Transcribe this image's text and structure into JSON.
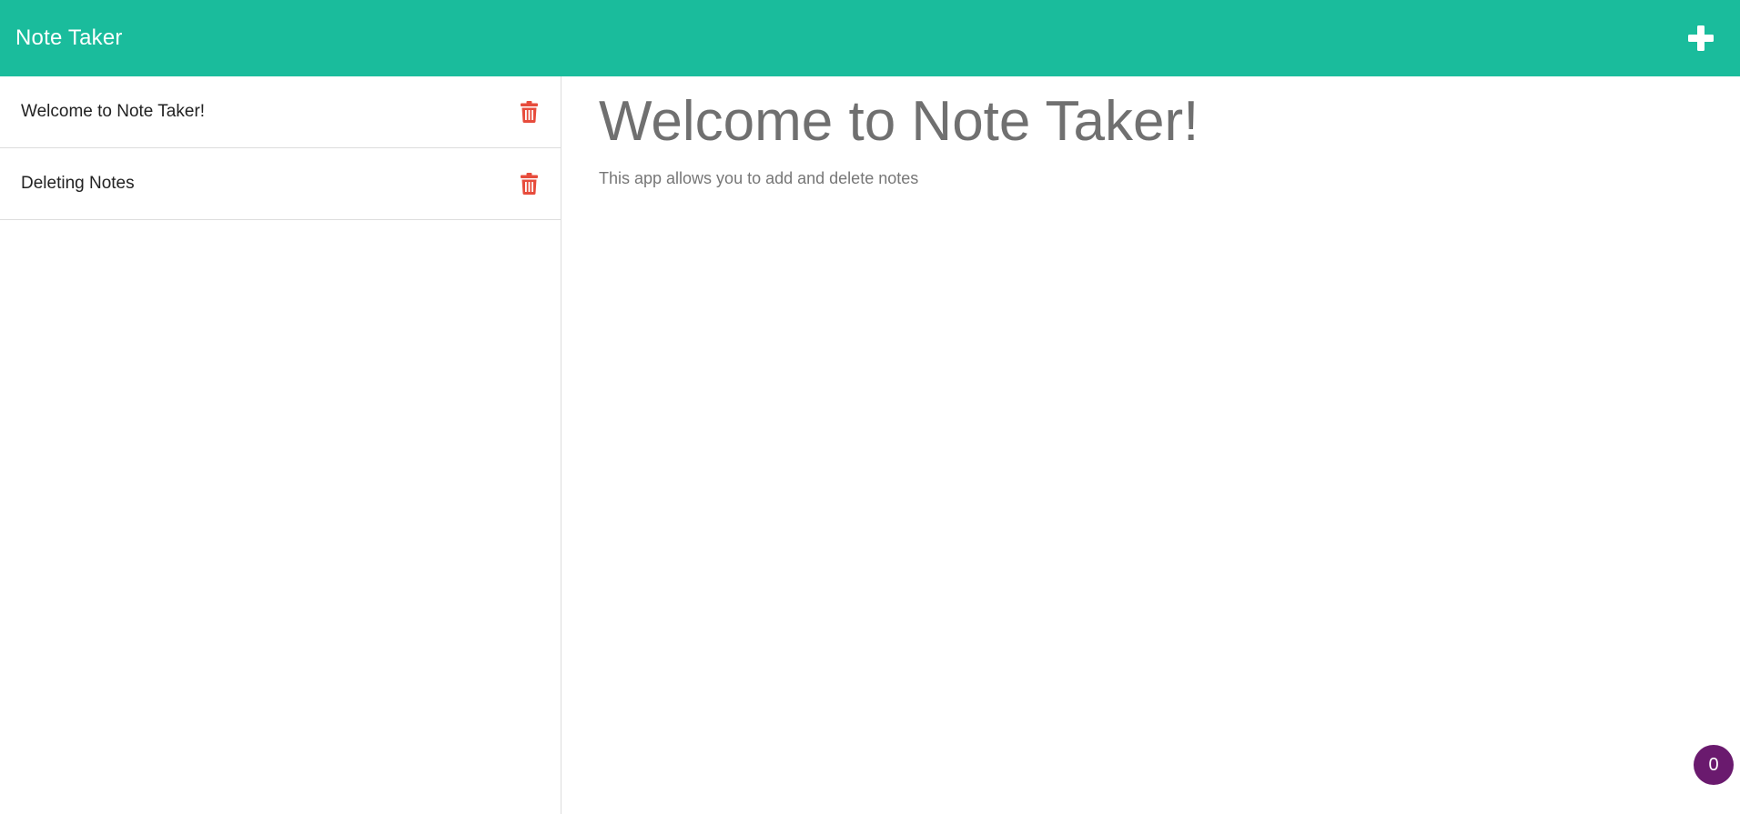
{
  "navbar": {
    "brand": "Note Taker",
    "add_icon": "plus-icon"
  },
  "sidebar": {
    "notes": [
      {
        "title": "Welcome to Note Taker!",
        "delete_icon": "trash-icon"
      },
      {
        "title": "Deleting Notes",
        "delete_icon": "trash-icon"
      }
    ]
  },
  "main": {
    "title": "Welcome to Note Taker!",
    "text": "This app allows you to add and delete notes"
  },
  "badge": {
    "count": "0"
  },
  "colors": {
    "navbar_bg": "#1abc9c",
    "delete_icon": "#e74c3c",
    "badge_bg": "#6a1a6e"
  }
}
